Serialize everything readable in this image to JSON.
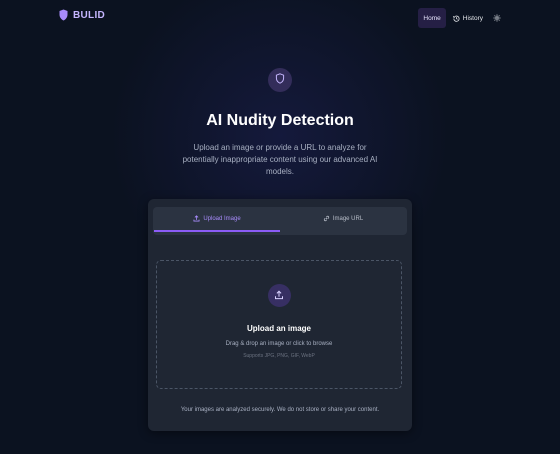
{
  "header": {
    "brand": "BULID",
    "nav": {
      "home": "Home",
      "history": "History"
    }
  },
  "hero": {
    "title": "AI Nudity Detection",
    "subtitle": "Upload an image or provide a URL to analyze for potentially inappropriate content using our advanced AI models."
  },
  "tabs": {
    "upload": "Upload Image",
    "url": "Image URL"
  },
  "dropzone": {
    "title": "Upload an image",
    "hint": "Drag & drop an image or click to browse",
    "formats": "Supports JPG, PNG, GIF, WebP"
  },
  "footer_note": "Your images are analyzed securely. We do not store or share your content.",
  "icons": {
    "brand": "shield-icon",
    "history": "history-icon",
    "settings": "settings-icon",
    "hero": "shield-icon",
    "upload_tab": "upload-icon",
    "url_tab": "link-icon",
    "dropzone": "upload-icon"
  },
  "colors": {
    "background": "#0b1220",
    "card": "#1f2633",
    "accent": "#8b5cf6",
    "brand": "#c4b5fd"
  }
}
